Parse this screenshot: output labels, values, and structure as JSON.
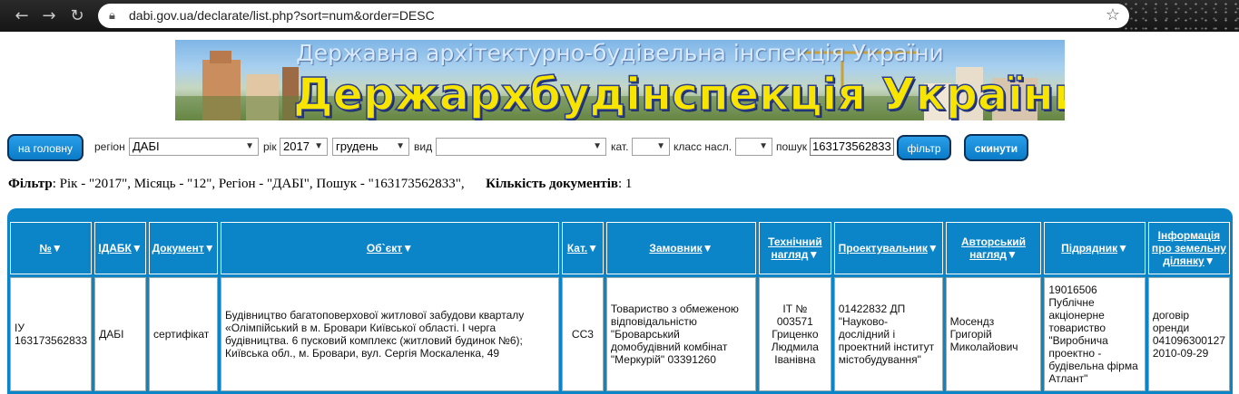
{
  "browser": {
    "url": "dabi.gov.ua/declarate/list.php?sort=num&order=DESC"
  },
  "banner": {
    "subtitle": "Державна архітектурно-будівельна інспекція України",
    "title": "Держархбудінспекція України"
  },
  "filters": {
    "home_label": "на головну",
    "region_label": "регіон",
    "region_value": "ДАБІ",
    "year_label": "рік",
    "year_value": "2017",
    "month_value": "грудень",
    "type_label": "вид",
    "type_value": "",
    "cat_label": "кат.",
    "cat_value": "",
    "class_label": "класс насл.",
    "class_value": "",
    "search_label": "пошук",
    "search_value": "163173562833",
    "filter_button": "фільтр",
    "reset_button": "скинути"
  },
  "summary": {
    "filter_label": "Фільтр",
    "filter_text": ": Рік - \"2017\", Місяць - \"12\", Регіон - \"ДАБІ\", Пошук - \"163173562833\",",
    "count_label": "Кількість документів",
    "count_text": ": 1"
  },
  "table": {
    "headers": {
      "num": "№",
      "idabk": "ІДАБК",
      "doc": "Документ",
      "object": "Об`єкт",
      "cat": "Кат.",
      "customer": "Замовник",
      "tech": "Технічний нагляд",
      "designer": "Проектувальник",
      "author": "Авторський нагляд",
      "contractor": "Підрядник",
      "land": "Інформація про земельну ділянку"
    },
    "row": {
      "num": "ІУ 163173562833",
      "idabk": "ДАБІ",
      "doc": "сертифікат",
      "object": "Будівництво багатоповерхової житлової забудови кварталу «Олімпійський в м. Бровари Київської області. І черга будівництва. 6 пусковий комплекс (житловий будинок №6); Київська обл., м. Бровари, вул. Сергія Москаленка, 49",
      "cat": "СС3",
      "customer": "Товариство з обмеженою відповідальністю \"Броварський домобудівний комбінат \"Меркурій\" 03391260",
      "tech": "ІТ № 003571 Гриценко Людмила Іванівна",
      "designer": "01422832 ДП \"Науково-дослідний і проектний інститут містобудування\"",
      "author": "Мосендз Григорій Миколайович",
      "contractor": "19016506 Публічне акціонерне товариство \"Виробнича проектно - будівельна фірма Атлант\"",
      "land": "договір оренди 041096300127 2010-09-29"
    }
  },
  "icons": {
    "sort": "triangle-down-icon",
    "dropdown": "chevron-down-icon"
  },
  "colors": {
    "accent": "#0b84c8",
    "button_border": "#0c2f55",
    "banner_title": "#f7e400"
  }
}
